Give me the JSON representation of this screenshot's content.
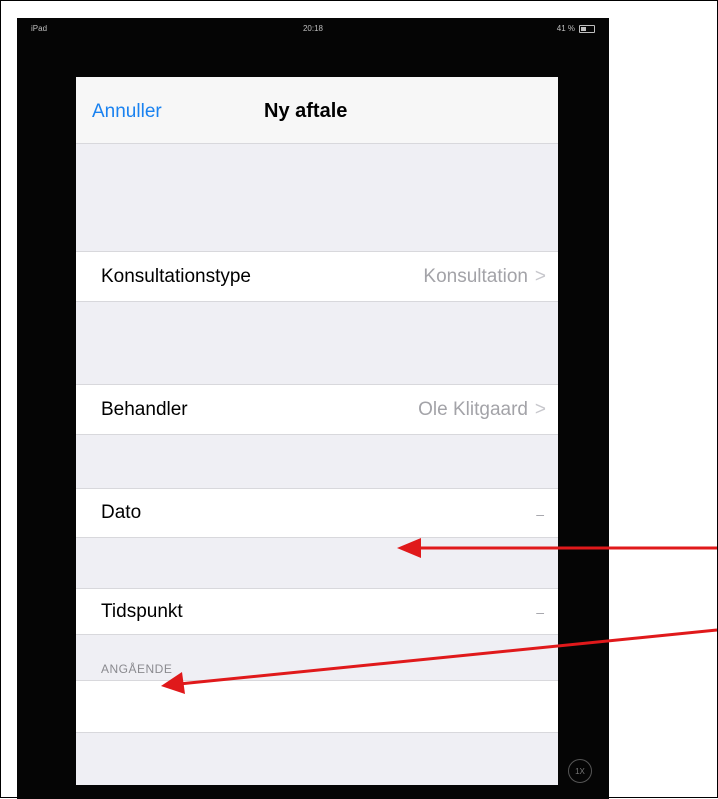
{
  "status_bar": {
    "carrier": "iPad",
    "time": "20:18",
    "battery": "41 %"
  },
  "navbar": {
    "cancel_label": "Annuller",
    "title": "Ny aftale"
  },
  "rows": {
    "consultation_type": {
      "label": "Konsultationstype",
      "value": "Konsultation",
      "chevron": ">"
    },
    "practitioner": {
      "label": "Behandler",
      "value": "Ole Klitgaard",
      "chevron": ">"
    },
    "date": {
      "label": "Dato",
      "value": "–"
    },
    "time": {
      "label": "Tidspunkt",
      "value": "–"
    }
  },
  "section": {
    "regarding_header": "ANGÅENDE",
    "regarding_value": ""
  },
  "home_button_label": "1X",
  "colors": {
    "accent": "#1a82f0",
    "annotation_arrow": "#e0191b",
    "background": "#efeff4"
  }
}
